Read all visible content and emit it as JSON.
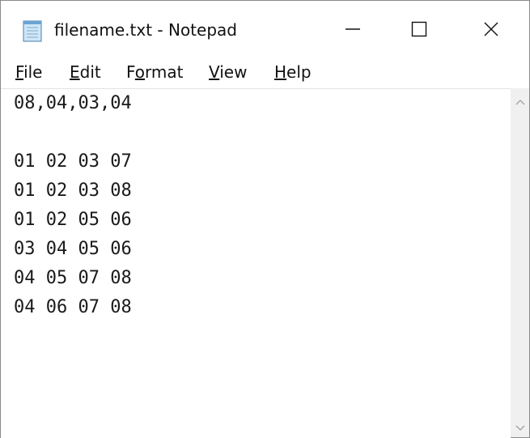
{
  "window": {
    "title": "filename.txt - Notepad",
    "icon": "notepad-icon",
    "controls": {
      "minimize_icon": "minimize-icon",
      "maximize_icon": "maximize-icon",
      "close_icon": "close-icon"
    }
  },
  "menu": {
    "items": [
      {
        "label": "File",
        "mnemonic": "F",
        "rest": "ile"
      },
      {
        "label": "Edit",
        "mnemonic": "E",
        "rest": "dit"
      },
      {
        "label": "Format",
        "pre": "F",
        "mnemonic": "o",
        "rest": "rmat"
      },
      {
        "label": "View",
        "mnemonic": "V",
        "rest": "iew"
      },
      {
        "label": "Help",
        "mnemonic": "H",
        "rest": "elp"
      }
    ]
  },
  "editor": {
    "lines": [
      "08,04,03,04",
      "",
      "01 02 03 07",
      "01 02 03 08",
      "01 02 05 06",
      "03 04 05 06",
      "04 05 07 08",
      "04 06 07 08"
    ]
  },
  "scrollbar": {
    "up_icon": "chevron-up-icon",
    "down_icon": "chevron-down-icon"
  },
  "colors": {
    "text": "#1a1a1a",
    "scrollbar_bg": "#f0f0f0",
    "window_border": "#8a8a8a"
  }
}
